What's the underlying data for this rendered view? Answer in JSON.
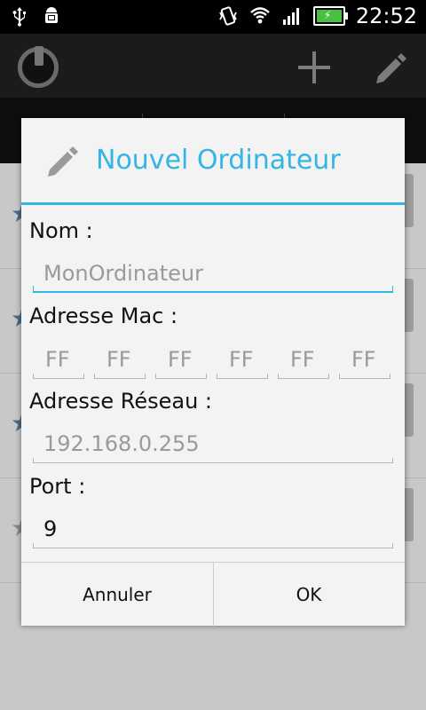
{
  "status_bar": {
    "time": "22:52",
    "left_icons": [
      "usb-icon",
      "android-debug-icon"
    ],
    "right_icons": [
      "vibrate-icon",
      "wifi-icon",
      "signal-icon",
      "battery-charging-icon"
    ]
  },
  "action_bar": {
    "icons": [
      "app-power-plug-icon",
      "plus-icon",
      "pencil-icon"
    ]
  },
  "dialog": {
    "title": "Nouvel Ordinateur",
    "title_icon": "pencil-icon",
    "accent_color": "#33b5e5",
    "name_label": "Nom :",
    "name_placeholder": "MonOrdinateur",
    "mac_label": "Adresse Mac :",
    "mac_octets": [
      "FF",
      "FF",
      "FF",
      "FF",
      "FF",
      "FF"
    ],
    "network_label": "Adresse Réseau :",
    "network_placeholder": "192.168.0.255",
    "port_label": "Port :",
    "port_value": "9",
    "cancel_label": "Annuler",
    "ok_label": "OK"
  }
}
